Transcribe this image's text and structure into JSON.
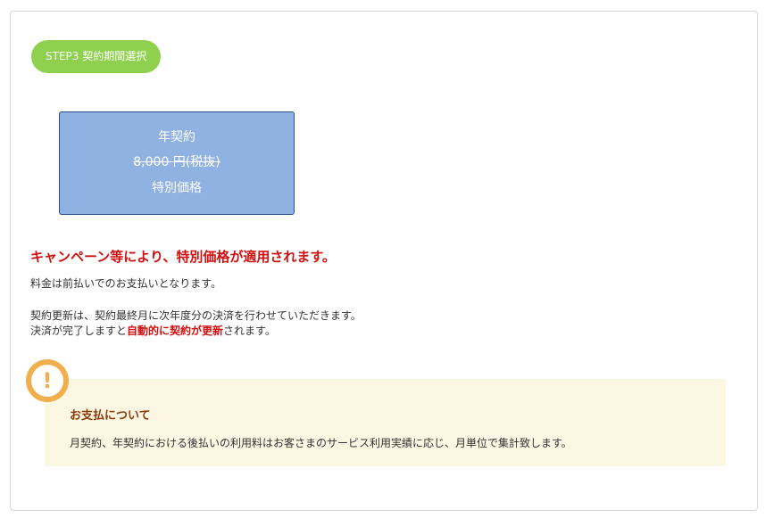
{
  "step": {
    "label": "STEP3 契約期間選択"
  },
  "plan": {
    "name": "年契約",
    "price": "8,000 円(税抜)",
    "special": "特別価格"
  },
  "campaign_notice": "キャンペーン等により、特別価格が適用されます。",
  "payment_text": "料金は前払いでのお支払いとなります。",
  "renewal": {
    "line1": "契約更新は、契約最終月に次年度分の決済を行わせていただきます。",
    "line2_before": "決済が完了しますと",
    "line2_highlight": "自動的に契約が更新",
    "line2_after": "されます。"
  },
  "info": {
    "icon": "exclamation-icon",
    "icon_glyph": "!",
    "title": "お支払について",
    "body": "月契約、年契約における後払いの利用料はお客さまのサービス利用実績に応じ、月単位で集計致します。"
  },
  "colors": {
    "step_pill": "#8fd14f",
    "plan_card": "#8fb2e2",
    "highlight_red": "#d40f0f",
    "info_bg": "#fbf7e3",
    "info_title": "#8a3c0a",
    "alert_icon": "#f0ae4c"
  }
}
